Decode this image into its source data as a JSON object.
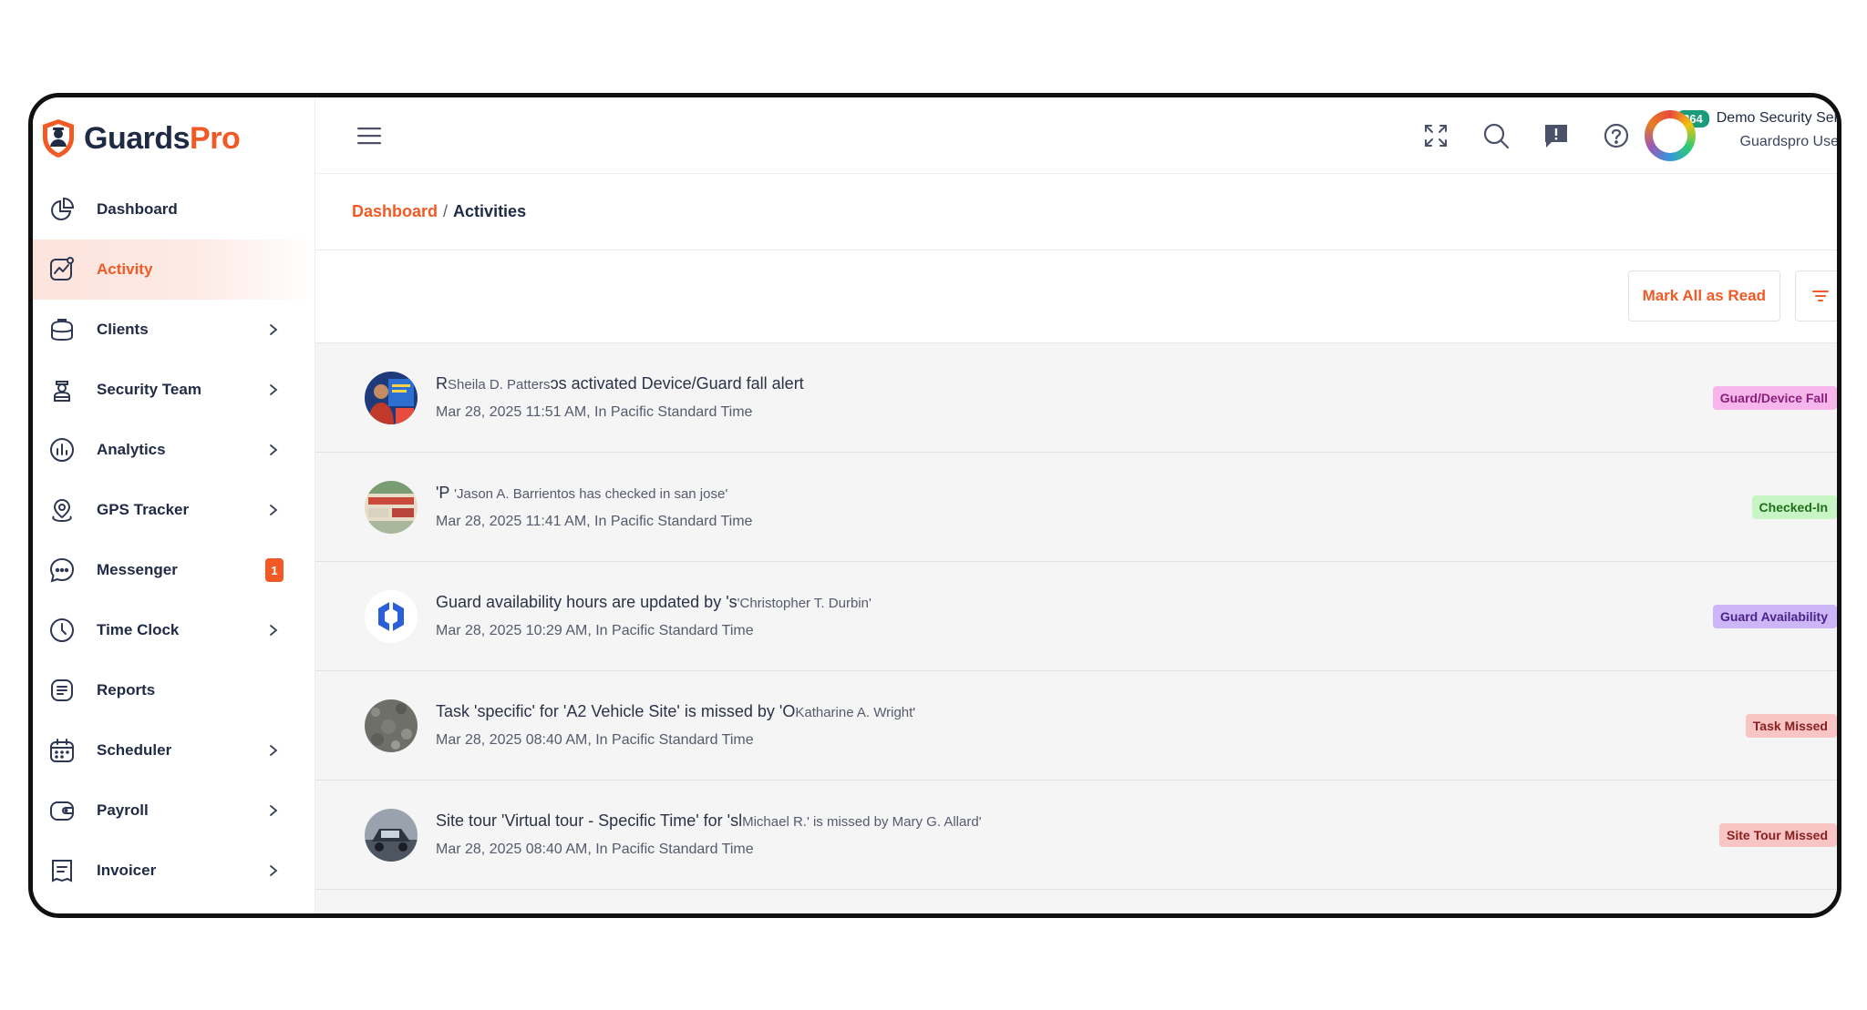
{
  "brand": {
    "name_part1": "Guards",
    "name_part2": "Pro",
    "primary_color": "#f15a24",
    "dark_color": "#1f2a44"
  },
  "sidebar": {
    "items": [
      {
        "label": "Dashboard",
        "icon": "pie-chart-icon",
        "has_chevron": false
      },
      {
        "label": "Activity",
        "icon": "activity-chart-icon",
        "has_chevron": false,
        "active": true
      },
      {
        "label": "Clients",
        "icon": "briefcase-icon",
        "has_chevron": true
      },
      {
        "label": "Security Team",
        "icon": "guard-icon",
        "has_chevron": true
      },
      {
        "label": "Analytics",
        "icon": "bar-chart-icon",
        "has_chevron": true
      },
      {
        "label": "GPS Tracker",
        "icon": "location-pin-icon",
        "has_chevron": true
      },
      {
        "label": "Messenger",
        "icon": "chat-bubble-icon",
        "has_chevron": false,
        "badge": "1"
      },
      {
        "label": "Time Clock",
        "icon": "clock-icon",
        "has_chevron": true
      },
      {
        "label": "Reports",
        "icon": "document-icon",
        "has_chevron": false
      },
      {
        "label": "Scheduler",
        "icon": "calendar-icon",
        "has_chevron": true
      },
      {
        "label": "Payroll",
        "icon": "wallet-icon",
        "has_chevron": true
      },
      {
        "label": "Invoicer",
        "icon": "invoice-icon",
        "has_chevron": true
      }
    ]
  },
  "topbar": {
    "notification_count": "264",
    "user_name": "Demo Security Ser",
    "user_role": "Guardspro Use"
  },
  "breadcrumb": {
    "parent": "Dashboard",
    "separator": "/",
    "current": "Activities"
  },
  "actions": {
    "mark_all_read": "Mark All as Read"
  },
  "activities": [
    {
      "title_lead": "R",
      "title_small": "Sheila D. Patters",
      "title_rest": "ɔs activated Device/Guard fall alert",
      "time": "Mar 28, 2025 11:51 AM, ",
      "tz_label": "In ",
      "tz": "Pacific Standard Time",
      "tag": "Guard/Device Fall"
    },
    {
      "title_lead": "'P ",
      "title_small": "'Jason A. Barrientos has checked in san jose'",
      "title_rest": "",
      "time": "Mar 28, 2025 11:41 AM, ",
      "tz_label": "In ",
      "tz": "Pacific Standard Time",
      "tag": "Checked-In"
    },
    {
      "title_lead": "Guard availability hours are updated by 's",
      "title_small": "'Christopher T. Durbin'",
      "title_rest": "",
      "time": "Mar 28, 2025 10:29 AM, ",
      "tz_label": "In ",
      "tz": "Pacific Standard Time",
      "tag": "Guard Availability"
    },
    {
      "title_lead": "Task 'specific' for 'A2 Vehicle Site' is missed by 'O",
      "title_small": "Katharine A. Wright'",
      "title_rest": "",
      "time": "Mar 28, 2025 08:40 AM, ",
      "tz_label": "In ",
      "tz": "Pacific Standard Time",
      "tag": "Task Missed"
    },
    {
      "title_lead": "Site tour 'Virtual tour - Specific Time' for 'sl",
      "title_small": "Michael R.' is missed by Mary G. Allard'",
      "title_rest": "",
      "time": "Mar 28, 2025 08:40 AM, ",
      "tz_label": "In ",
      "tz": "Pacific Standard Time",
      "tag": "Site Tour Missed"
    }
  ]
}
